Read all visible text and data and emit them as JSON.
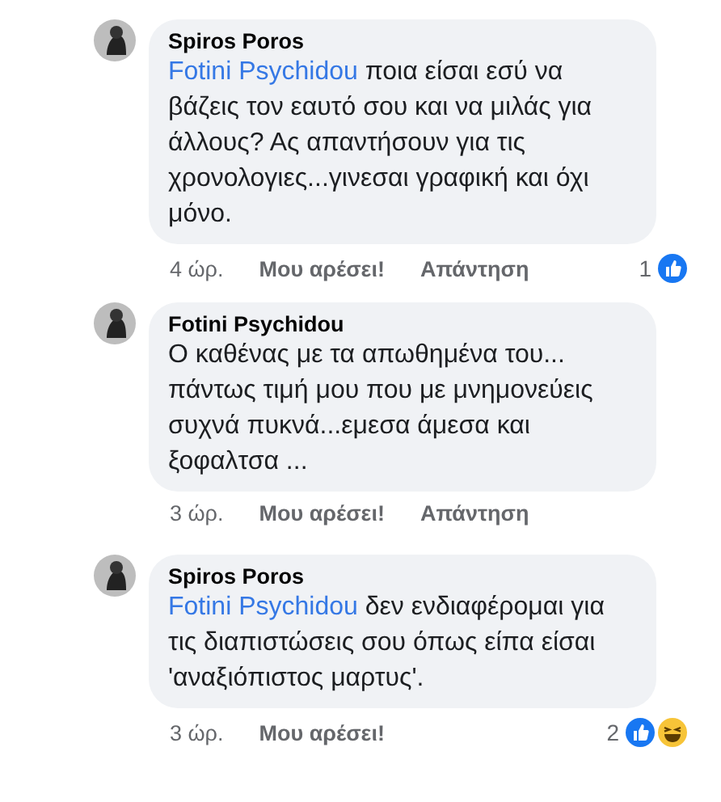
{
  "comments": [
    {
      "author": "Spiros Poros",
      "mention": "Fotini Psychidou",
      "text": "ποια είσαι εσύ να βάζεις τον εαυτό σου και να μιλάς για άλλους? Ας απαντήσουν για τις χρονολογιες...γινεσαι γραφική και όχι μόνο.",
      "actions": [
        {
          "kind": "time",
          "label": "4 ώρ."
        },
        {
          "kind": "like",
          "label": "Μου αρέσει!"
        },
        {
          "kind": "reply",
          "label": "Απάντηση"
        }
      ],
      "reaction_count": "1",
      "reactions": [
        {
          "kind": "like"
        }
      ]
    },
    {
      "author": "Fotini Psychidou",
      "text": "Ο καθένας με τα απωθημένα του... πάντως τιμή μου που με μνημονεύεις συχνά πυκνά...εμεσα άμεσα και ξοφαλτσα ...",
      "actions": [
        {
          "kind": "time",
          "label": "3 ώρ."
        },
        {
          "kind": "like",
          "label": "Μου αρέσει!"
        },
        {
          "kind": "reply",
          "label": "Απάντηση"
        }
      ]
    },
    {
      "author": "Spiros Poros",
      "mention": "Fotini Psychidou",
      "text": "δεν ενδιαφέρομαι για τις διαπιστώσεις σου όπως είπα είσαι 'αναξιόπιστος μαρτυς'.",
      "actions": [
        {
          "kind": "time",
          "label": "3 ώρ."
        },
        {
          "kind": "like",
          "label": "Μου αρέσει!"
        }
      ],
      "reaction_count": "2",
      "reactions": [
        {
          "kind": "like"
        },
        {
          "kind": "haha"
        }
      ]
    }
  ]
}
